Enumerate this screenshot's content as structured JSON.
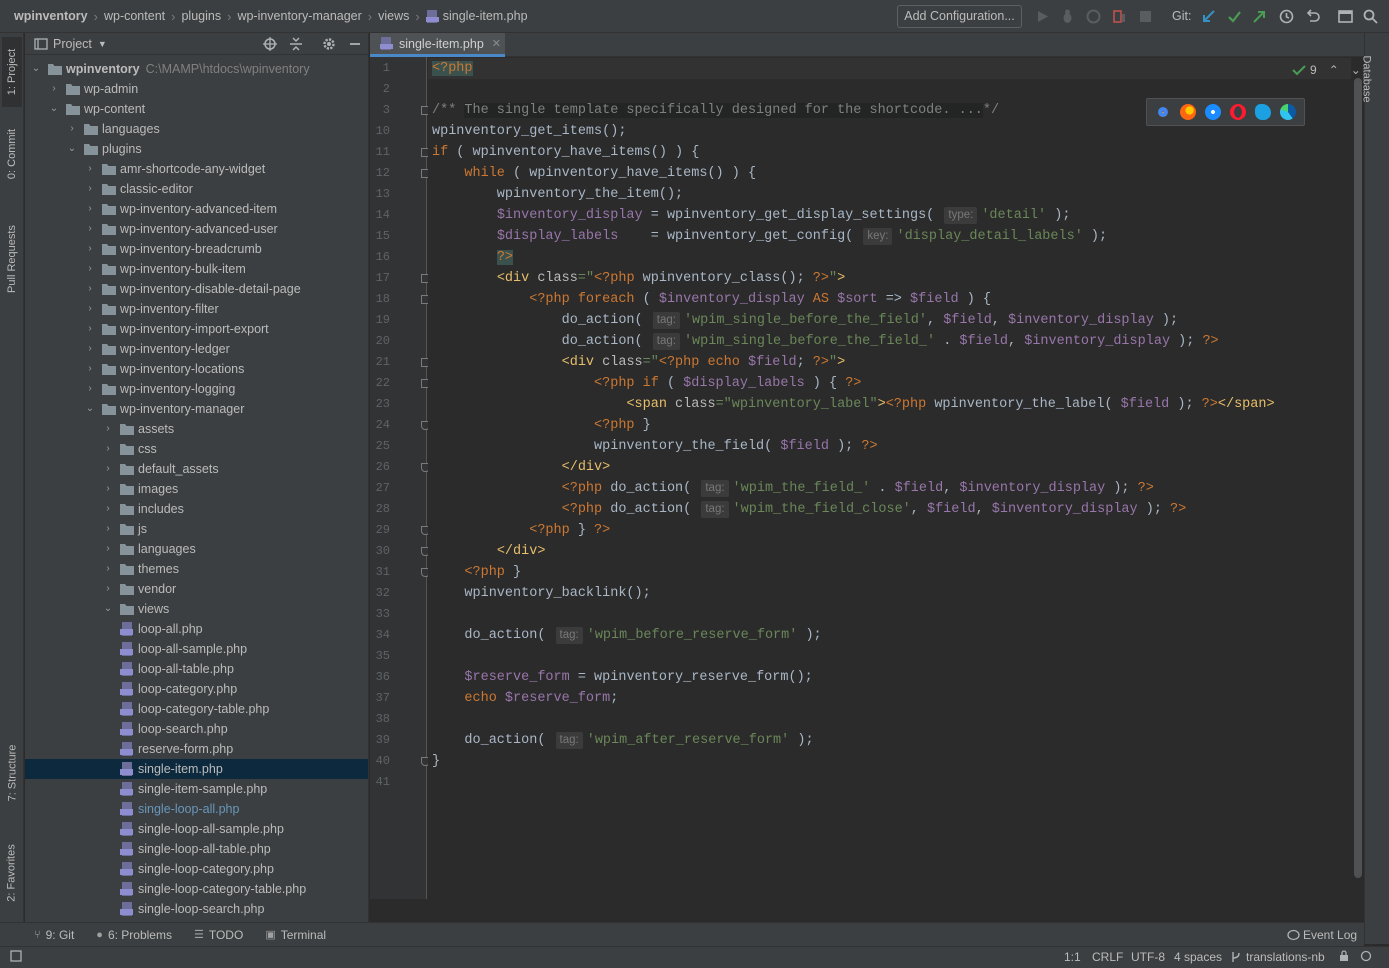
{
  "breadcrumb": [
    "wpinventory",
    "wp-content",
    "plugins",
    "wp-inventory-manager",
    "views",
    "single-item.php"
  ],
  "toolbar": {
    "add_config": "Add Configuration...",
    "git_label": "Git:"
  },
  "left_strip": {
    "project": "1: Project",
    "commit": "0: Commit",
    "pull_requests": "Pull Requests",
    "structure": "7: Structure",
    "favorites": "2: Favorites"
  },
  "right_strip": {
    "database": "Database"
  },
  "project_panel": {
    "title": "Project",
    "root_name": "wpinventory",
    "root_path": "C:\\MAMP\\htdocs\\wpinventory",
    "items": [
      {
        "depth": 1,
        "type": "folder",
        "open": false,
        "label": "wp-admin"
      },
      {
        "depth": 1,
        "type": "folder",
        "open": true,
        "label": "wp-content"
      },
      {
        "depth": 2,
        "type": "folder",
        "open": false,
        "label": "languages"
      },
      {
        "depth": 2,
        "type": "folder",
        "open": true,
        "label": "plugins"
      },
      {
        "depth": 3,
        "type": "folder",
        "open": false,
        "label": "amr-shortcode-any-widget"
      },
      {
        "depth": 3,
        "type": "folder",
        "open": false,
        "label": "classic-editor"
      },
      {
        "depth": 3,
        "type": "folder",
        "open": false,
        "label": "wp-inventory-advanced-item"
      },
      {
        "depth": 3,
        "type": "folder",
        "open": false,
        "label": "wp-inventory-advanced-user"
      },
      {
        "depth": 3,
        "type": "folder",
        "open": false,
        "label": "wp-inventory-breadcrumb"
      },
      {
        "depth": 3,
        "type": "folder",
        "open": false,
        "label": "wp-inventory-bulk-item"
      },
      {
        "depth": 3,
        "type": "folder",
        "open": false,
        "label": "wp-inventory-disable-detail-page"
      },
      {
        "depth": 3,
        "type": "folder",
        "open": false,
        "label": "wp-inventory-filter"
      },
      {
        "depth": 3,
        "type": "folder",
        "open": false,
        "label": "wp-inventory-import-export"
      },
      {
        "depth": 3,
        "type": "folder",
        "open": false,
        "label": "wp-inventory-ledger"
      },
      {
        "depth": 3,
        "type": "folder",
        "open": false,
        "label": "wp-inventory-locations"
      },
      {
        "depth": 3,
        "type": "folder",
        "open": false,
        "label": "wp-inventory-logging"
      },
      {
        "depth": 3,
        "type": "folder",
        "open": true,
        "label": "wp-inventory-manager"
      },
      {
        "depth": 4,
        "type": "folder",
        "open": false,
        "label": "assets"
      },
      {
        "depth": 4,
        "type": "folder",
        "open": false,
        "label": "css"
      },
      {
        "depth": 4,
        "type": "folder",
        "open": false,
        "label": "default_assets"
      },
      {
        "depth": 4,
        "type": "folder",
        "open": false,
        "label": "images"
      },
      {
        "depth": 4,
        "type": "folder",
        "open": false,
        "label": "includes"
      },
      {
        "depth": 4,
        "type": "folder",
        "open": false,
        "label": "js"
      },
      {
        "depth": 4,
        "type": "folder",
        "open": false,
        "label": "languages"
      },
      {
        "depth": 4,
        "type": "folder",
        "open": false,
        "label": "themes"
      },
      {
        "depth": 4,
        "type": "folder",
        "open": false,
        "label": "vendor"
      },
      {
        "depth": 4,
        "type": "folder",
        "open": true,
        "label": "views"
      },
      {
        "depth": 5,
        "type": "php",
        "label": "loop-all.php"
      },
      {
        "depth": 5,
        "type": "php",
        "label": "loop-all-sample.php"
      },
      {
        "depth": 5,
        "type": "php",
        "label": "loop-all-table.php"
      },
      {
        "depth": 5,
        "type": "php",
        "label": "loop-category.php"
      },
      {
        "depth": 5,
        "type": "php",
        "label": "loop-category-table.php"
      },
      {
        "depth": 5,
        "type": "php",
        "label": "loop-search.php"
      },
      {
        "depth": 5,
        "type": "php",
        "label": "reserve-form.php"
      },
      {
        "depth": 5,
        "type": "php",
        "label": "single-item.php",
        "selected": true
      },
      {
        "depth": 5,
        "type": "php",
        "label": "single-item-sample.php"
      },
      {
        "depth": 5,
        "type": "php",
        "label": "single-loop-all.php",
        "modified": true
      },
      {
        "depth": 5,
        "type": "php",
        "label": "single-loop-all-sample.php"
      },
      {
        "depth": 5,
        "type": "php",
        "label": "single-loop-all-table.php"
      },
      {
        "depth": 5,
        "type": "php",
        "label": "single-loop-category.php"
      },
      {
        "depth": 5,
        "type": "php",
        "label": "single-loop-category-table.php"
      },
      {
        "depth": 5,
        "type": "php",
        "label": "single-loop-search.php"
      }
    ]
  },
  "editor": {
    "tab_label": "single-item.php",
    "inspection_count": "9",
    "line_numbers": [
      "1",
      "2",
      "3",
      "10",
      "11",
      "12",
      "13",
      "14",
      "15",
      "16",
      "17",
      "18",
      "19",
      "20",
      "21",
      "22",
      "23",
      "24",
      "25",
      "26",
      "27",
      "28",
      "29",
      "30",
      "31",
      "32",
      "33",
      "34",
      "35",
      "36",
      "37",
      "38",
      "39",
      "40",
      "41"
    ],
    "lines": [
      [
        {
          "t": "<?php",
          "c": "pb"
        }
      ],
      [],
      [
        {
          "t": "/** ",
          "c": "c"
        },
        {
          "t": "The single template specifically designed for the shortcode. ...",
          "c": "c pp"
        },
        {
          "t": "*/",
          "c": "c"
        }
      ],
      [
        {
          "t": "wpinventory_get_items();"
        }
      ],
      [
        {
          "t": "if",
          "c": "k"
        },
        {
          "t": " ( wpinventory_have_items() ) {"
        }
      ],
      [
        {
          "t": "    "
        },
        {
          "t": "while",
          "c": "k"
        },
        {
          "t": " ( wpinventory_have_items() ) {"
        }
      ],
      [
        {
          "t": "        wpinventory_the_item();"
        }
      ],
      [
        {
          "t": "        "
        },
        {
          "t": "$inventory_display",
          "c": "v"
        },
        {
          "t": " = wpinventory_get_display_settings( "
        },
        {
          "t": "type:",
          "c": "tg"
        },
        {
          "t": "'detail'",
          "c": "s"
        },
        {
          "t": " );"
        }
      ],
      [
        {
          "t": "        "
        },
        {
          "t": "$display_labels",
          "c": "v"
        },
        {
          "t": "    = wpinventory_get_config( "
        },
        {
          "t": "key:",
          "c": "tg"
        },
        {
          "t": "'display_detail_labels'",
          "c": "s"
        },
        {
          "t": " );"
        }
      ],
      [
        {
          "t": "        "
        },
        {
          "t": "?>",
          "c": "pb"
        }
      ],
      [
        {
          "t": "        "
        },
        {
          "t": "<div ",
          "c": "h"
        },
        {
          "t": "class",
          "c": "a"
        },
        {
          "t": "=\"",
          "c": "s"
        },
        {
          "t": "<?php ",
          "c": "ph"
        },
        {
          "t": "wpinventory_class(); "
        },
        {
          "t": "?>",
          "c": "ph"
        },
        {
          "t": "\"",
          "c": "s"
        },
        {
          "t": ">",
          "c": "h"
        }
      ],
      [
        {
          "t": "            "
        },
        {
          "t": "<?php ",
          "c": "ph"
        },
        {
          "t": "foreach",
          "c": "k"
        },
        {
          "t": " ( "
        },
        {
          "t": "$inventory_display",
          "c": "v"
        },
        {
          "t": " AS ",
          "c": "k"
        },
        {
          "t": "$sort",
          "c": "v"
        },
        {
          "t": " => "
        },
        {
          "t": "$field",
          "c": "v"
        },
        {
          "t": " ) {"
        }
      ],
      [
        {
          "t": "                do_action( "
        },
        {
          "t": "tag:",
          "c": "tg"
        },
        {
          "t": "'wpim_single_before_the_field'",
          "c": "s"
        },
        {
          "t": ", "
        },
        {
          "t": "$field",
          "c": "v"
        },
        {
          "t": ", "
        },
        {
          "t": "$inventory_display",
          "c": "v"
        },
        {
          "t": " );"
        }
      ],
      [
        {
          "t": "                do_action( "
        },
        {
          "t": "tag:",
          "c": "tg"
        },
        {
          "t": "'wpim_single_before_the_field_'",
          "c": "s"
        },
        {
          "t": " . "
        },
        {
          "t": "$field",
          "c": "v"
        },
        {
          "t": ", "
        },
        {
          "t": "$inventory_display",
          "c": "v"
        },
        {
          "t": " ); "
        },
        {
          "t": "?>",
          "c": "ph"
        }
      ],
      [
        {
          "t": "                "
        },
        {
          "t": "<div ",
          "c": "h"
        },
        {
          "t": "class",
          "c": "a"
        },
        {
          "t": "=\"",
          "c": "s"
        },
        {
          "t": "<?php ",
          "c": "ph"
        },
        {
          "t": "echo ",
          "c": "k"
        },
        {
          "t": "$field",
          "c": "v"
        },
        {
          "t": "; "
        },
        {
          "t": "?>",
          "c": "ph"
        },
        {
          "t": "\"",
          "c": "s"
        },
        {
          "t": ">",
          "c": "h"
        }
      ],
      [
        {
          "t": "                    "
        },
        {
          "t": "<?php ",
          "c": "ph"
        },
        {
          "t": "if",
          "c": "k"
        },
        {
          "t": " ( "
        },
        {
          "t": "$display_labels",
          "c": "v"
        },
        {
          "t": " ) { "
        },
        {
          "t": "?>",
          "c": "ph"
        }
      ],
      [
        {
          "t": "                        "
        },
        {
          "t": "<span ",
          "c": "h"
        },
        {
          "t": "class",
          "c": "a"
        },
        {
          "t": "=\"wpinventory_label\"",
          "c": "s"
        },
        {
          "t": ">",
          "c": "h"
        },
        {
          "t": "<?php ",
          "c": "ph"
        },
        {
          "t": "wpinventory_the_label( "
        },
        {
          "t": "$field",
          "c": "v"
        },
        {
          "t": " ); "
        },
        {
          "t": "?>",
          "c": "ph"
        },
        {
          "t": "</span>",
          "c": "h"
        }
      ],
      [
        {
          "t": "                    "
        },
        {
          "t": "<?php ",
          "c": "ph"
        },
        {
          "t": "}"
        }
      ],
      [
        {
          "t": "                    wpinventory_the_field( "
        },
        {
          "t": "$field",
          "c": "v"
        },
        {
          "t": " ); "
        },
        {
          "t": "?>",
          "c": "ph"
        }
      ],
      [
        {
          "t": "                "
        },
        {
          "t": "</div>",
          "c": "h"
        }
      ],
      [
        {
          "t": "                "
        },
        {
          "t": "<?php ",
          "c": "ph"
        },
        {
          "t": "do_action( "
        },
        {
          "t": "tag:",
          "c": "tg"
        },
        {
          "t": "'wpim_the_field_'",
          "c": "s"
        },
        {
          "t": " . "
        },
        {
          "t": "$field",
          "c": "v"
        },
        {
          "t": ", "
        },
        {
          "t": "$inventory_display",
          "c": "v"
        },
        {
          "t": " ); "
        },
        {
          "t": "?>",
          "c": "ph"
        }
      ],
      [
        {
          "t": "                "
        },
        {
          "t": "<?php ",
          "c": "ph"
        },
        {
          "t": "do_action( "
        },
        {
          "t": "tag:",
          "c": "tg"
        },
        {
          "t": "'wpim_the_field_close'",
          "c": "s"
        },
        {
          "t": ", "
        },
        {
          "t": "$field",
          "c": "v"
        },
        {
          "t": ", "
        },
        {
          "t": "$inventory_display",
          "c": "v"
        },
        {
          "t": " ); "
        },
        {
          "t": "?>",
          "c": "ph"
        }
      ],
      [
        {
          "t": "            "
        },
        {
          "t": "<?php ",
          "c": "ph"
        },
        {
          "t": "} "
        },
        {
          "t": "?>",
          "c": "ph"
        }
      ],
      [
        {
          "t": "        "
        },
        {
          "t": "</div>",
          "c": "h"
        }
      ],
      [
        {
          "t": "    "
        },
        {
          "t": "<?php ",
          "c": "ph"
        },
        {
          "t": "}"
        }
      ],
      [
        {
          "t": "    wpinventory_backlink();"
        }
      ],
      [],
      [
        {
          "t": "    do_action( "
        },
        {
          "t": "tag:",
          "c": "tg"
        },
        {
          "t": "'wpim_before_reserve_form'",
          "c": "s"
        },
        {
          "t": " );"
        }
      ],
      [],
      [
        {
          "t": "    "
        },
        {
          "t": "$reserve_form",
          "c": "v"
        },
        {
          "t": " = wpinventory_reserve_form();"
        }
      ],
      [
        {
          "t": "    "
        },
        {
          "t": "echo ",
          "c": "k"
        },
        {
          "t": "$reserve_form",
          "c": "v"
        },
        {
          "t": ";"
        }
      ],
      [],
      [
        {
          "t": "    do_action( "
        },
        {
          "t": "tag:",
          "c": "tg"
        },
        {
          "t": "'wpim_after_reserve_form'",
          "c": "s"
        },
        {
          "t": " );"
        }
      ],
      [
        {
          "t": "}"
        }
      ],
      []
    ]
  },
  "bottom_tools": [
    {
      "icon": "git-branch-icon",
      "label": "9: Git"
    },
    {
      "icon": "problems-icon",
      "label": "6: Problems"
    },
    {
      "icon": "todo-icon",
      "label": "TODO"
    },
    {
      "icon": "terminal-icon",
      "label": "Terminal"
    }
  ],
  "event_log": "Event Log",
  "status": {
    "position": "1:1",
    "line_sep": "CRLF",
    "encoding": "UTF-8",
    "indent": "4 spaces",
    "branch": "translations-nb"
  },
  "colors": {
    "accent": "#4a88c7",
    "selection": "#0d293e",
    "keyword": "#cc7832",
    "function": "#ffc66d",
    "variable": "#9876aa",
    "string": "#6a8759",
    "comment": "#808080"
  }
}
